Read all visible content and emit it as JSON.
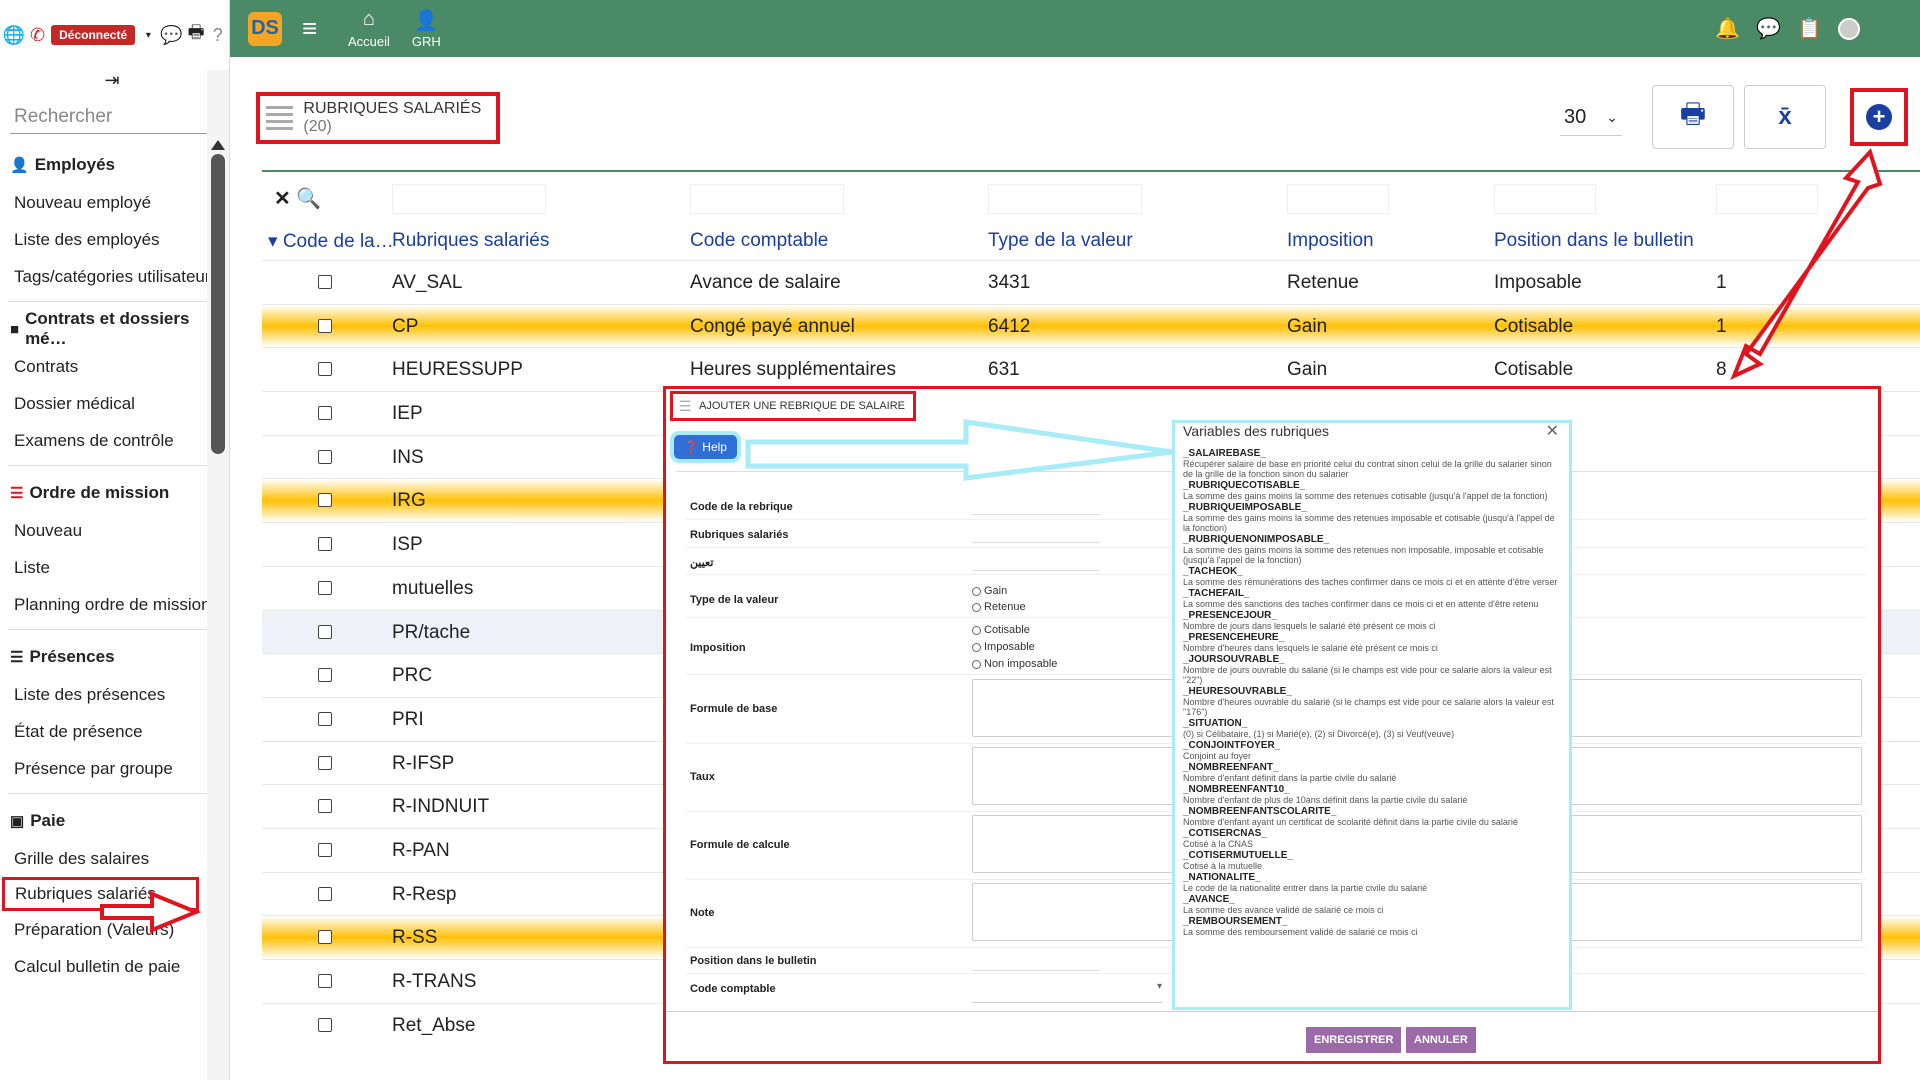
{
  "sidebar": {
    "status_badge": "Déconnecté",
    "search_placeholder": "Rechercher",
    "sections": [
      {
        "title": "Employés",
        "items": [
          "Nouveau employé",
          "Liste des employés",
          "Tags/catégories utilisateurs"
        ]
      },
      {
        "title": "Contrats et dossiers mé…",
        "items": [
          "Contrats",
          "Dossier médical",
          "Examens de contrôle"
        ]
      },
      {
        "title": "Ordre de mission",
        "items": [
          "Nouveau",
          "Liste",
          "Planning ordre de mission"
        ]
      },
      {
        "title": "Présences",
        "items": [
          "Liste des présences",
          "État de présence",
          "Présence par groupe"
        ]
      },
      {
        "title": "Paie",
        "items": [
          "Grille des salaires",
          "Rubriques salariés",
          "Préparation (Valeurs)",
          "Calcul bulletin de paie"
        ]
      }
    ]
  },
  "topbar": {
    "logo": "DS",
    "nav": [
      {
        "label": "Accueil"
      },
      {
        "label": "GRH"
      }
    ]
  },
  "page": {
    "title": "RUBRIQUES SALARIÉS",
    "count": "(20)",
    "page_size": "30"
  },
  "table": {
    "columns": [
      "Code de la…",
      "Rubriques salariés",
      "Code comptable",
      "Type de la valeur",
      "Imposition",
      "Position dans le bulletin"
    ],
    "rows": [
      {
        "code": "AV_SAL",
        "rubrique": "Avance de salaire",
        "compte": "3431",
        "type": "Retenue",
        "imposition": "Imposable",
        "position": "1",
        "hl": false
      },
      {
        "code": "CP",
        "rubrique": "Congé payé annuel",
        "compte": "6412",
        "type": "Gain",
        "imposition": "Cotisable",
        "position": "1",
        "hl": true
      },
      {
        "code": "HEURESSUPP",
        "rubrique": "Heures supplémentaires",
        "compte": "631",
        "type": "Gain",
        "imposition": "Cotisable",
        "position": "8",
        "hl": false
      },
      {
        "code": "IEP",
        "hl": false
      },
      {
        "code": "INS",
        "hl": false
      },
      {
        "code": "IRG",
        "hl": true
      },
      {
        "code": "ISP",
        "hl": false
      },
      {
        "code": "mutuelles",
        "hl": false
      },
      {
        "code": "PR/tache",
        "sel": true,
        "hl": false
      },
      {
        "code": "PRC",
        "hl": false
      },
      {
        "code": "PRI",
        "hl": false
      },
      {
        "code": "R-IFSP",
        "hl": false
      },
      {
        "code": "R-INDNUIT",
        "hl": false
      },
      {
        "code": "R-PAN",
        "hl": false
      },
      {
        "code": "R-Resp",
        "hl": false
      },
      {
        "code": "R-SS",
        "hl": true
      },
      {
        "code": "R-TRANS",
        "hl": false
      },
      {
        "code": "Ret_Abse",
        "hl": false
      }
    ]
  },
  "modal": {
    "title": "AJOUTER UNE REBRIQUE DE SALAIRE",
    "help": "Help",
    "labels": {
      "code": "Code de la rebrique",
      "rubrique": "Rubriques salariés",
      "arabic": "تعيين",
      "type": "Type de la valeur",
      "imposition": "Imposition",
      "formule_base": "Formule de base",
      "taux": "Taux",
      "formule_calcule": "Formule de calcule",
      "note": "Note",
      "position": "Position dans le bulletin",
      "code_comptable": "Code comptable"
    },
    "type_options": [
      "Gain",
      "Retenue"
    ],
    "imposition_options": [
      "Cotisable",
      "Imposable",
      "Non imposable"
    ],
    "save": "ENREGISTRER",
    "cancel": "ANNULER"
  },
  "variables": {
    "title": "Variables des rubriques",
    "items": [
      {
        "name": "_SALAIREBASE_",
        "desc": "Récupérer salaire de base en priorité celui du contrat sinon celui de la grille du salarier sinon de la grille de la fonction sinon du salarier"
      },
      {
        "name": "_RUBRIQUECOTISABLE_",
        "desc": "La somme des gains moins la somme des retenues cotisable (jusqu'à l'appel de la fonction)"
      },
      {
        "name": "_RUBRIQUEIMPOSABLE_",
        "desc": "La somme des gains moins la somme des retenues imposable et cotisable (jusqu'à l'appel de la fonction)"
      },
      {
        "name": "_RUBRIQUENONIMPOSABLE_",
        "desc": "La somme des gains moins la somme des retenues non imposable, imposable et cotisable (jusqu'à l'appel de la fonction)"
      },
      {
        "name": "_TACHEOK_",
        "desc": "La somme des rémunérations des taches confirmer dans ce mois ci et en attente d'être verser"
      },
      {
        "name": "_TACHEFAIL_",
        "desc": "La somme des sanctions des taches confirmer dans ce mois ci et en attente d'être retenu"
      },
      {
        "name": "_PRESENCEJOUR_",
        "desc": "Nombre de jours dans lesquels le salarié été présent ce mois ci"
      },
      {
        "name": "_PRESENCEHEURE_",
        "desc": "Nombre d'heures dans lesquels le salarié été présent ce mois ci"
      },
      {
        "name": "_JOURSOUVRABLE_",
        "desc": "Nombre de jours ouvrable du salarié (si le champs est vide pour ce salarie alors la valeur est \"22\")"
      },
      {
        "name": "_HEURESOUVRABLE_",
        "desc": "Nombre d'heures ouvrable du salarié (si le champs est vide pour ce salarie alors la valeur est \"176\")"
      },
      {
        "name": "_SITUATION_",
        "desc": "(0) si Célibataire, (1) si Marié(e), (2) si Divorcé(e), (3) si Veuf(veuve)"
      },
      {
        "name": "_CONJOINTFOYER_",
        "desc": "Conjoint au foyer"
      },
      {
        "name": "_NOMBREENFANT_",
        "desc": "Nombre d'enfant définit dans la partie civile du salarié"
      },
      {
        "name": "_NOMBREENFANT10_",
        "desc": "Nombre d'enfant de plus de 10ans définit dans la partie civile du salarié"
      },
      {
        "name": "_NOMBREENFANTSCOLARITE_",
        "desc": "Nombre d'enfant ayant un certificat de scolarité définit dans la partie civile du salarié"
      },
      {
        "name": "_COTISERCNAS_",
        "desc": "Cotisé à la CNAS"
      },
      {
        "name": "_COTISERMUTUELLE_",
        "desc": "Cotisé à la mutuelle"
      },
      {
        "name": "_NATIONALITE_",
        "desc": "Le code de la nationalité entrer dans la partie civile du salarié"
      },
      {
        "name": "_AVANCE_",
        "desc": "La somme des avance validé de salarié ce mois ci"
      },
      {
        "name": "_REMBOURSEMENT_",
        "desc": "La somme des remboursement validé de salarié ce mois ci"
      }
    ]
  },
  "colors": {
    "topbar": "#4b8a66",
    "highlight": "#ffc107",
    "annotation": "#e0141e",
    "help_arrow": "#a7ecf7",
    "accent": "#1a3fa0"
  }
}
